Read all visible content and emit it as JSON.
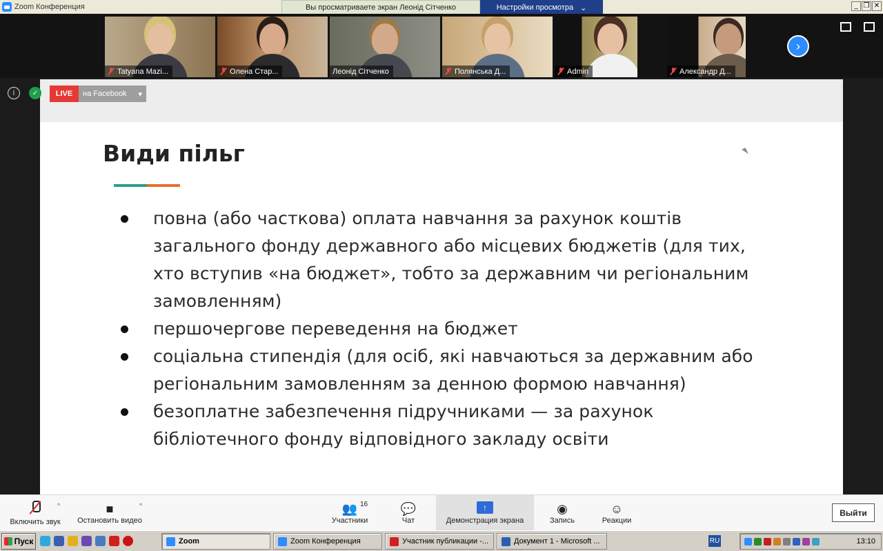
{
  "window": {
    "title": "Zoom Конференция",
    "share_notice": "Вы просматриваете экран Леонід Сітченко",
    "view_settings": "Настройки просмотра",
    "view_settings_caret": "⌄",
    "minimize": "_",
    "restore": "❐",
    "close": "✕"
  },
  "gallery": {
    "participants": [
      {
        "name": "Tatyana Mazi...",
        "muted": true
      },
      {
        "name": "Олена Стар...",
        "muted": true
      },
      {
        "name": "Леонід Сітченко",
        "muted": false,
        "active": true
      },
      {
        "name": "Полянська Д...",
        "muted": true
      },
      {
        "name": "Admin",
        "muted": true
      },
      {
        "name": "Александр Д...",
        "muted": true
      }
    ],
    "next_page": "›"
  },
  "meeting": {
    "info_icon": "i",
    "security_icon": "✓",
    "live_label": "LIVE",
    "live_destination": "на Facebook",
    "live_caret": "▾"
  },
  "slide": {
    "title": "Види пільг",
    "bullets": [
      "повна (або часткова) оплата навчання за рахунок коштів загального фонду державного або місцевих бюджетів (для тих, хто вступив «на бюджет», тобто за державним чи регіональним замовленням)",
      "першочергове переведення на бюджет",
      "соціальна стипендія (для осіб, які навчаються за державним або регіональним замовленням за денною формою навчання)",
      "безоплатне забезпечення підручниками — за рахунок бібліотечного фонду відповідного закладу освіти"
    ],
    "accent_colors": [
      "#2a9d8f",
      "#e76f2a"
    ]
  },
  "toolbar": {
    "unmute": "Включить звук",
    "stop_video": "Остановить видео",
    "participants": "Участники",
    "participants_count": "16",
    "chat": "Чат",
    "share_screen": "Демонстрация экрана",
    "record": "Запись",
    "reactions": "Реакции",
    "leave": "Выйти",
    "caret": "^"
  },
  "taskbar": {
    "start": "Пуск",
    "tasks": [
      {
        "label": "Zoom",
        "active": true
      },
      {
        "label": "Zoom Конференция",
        "active": false
      },
      {
        "label": "Участник публикации -...",
        "active": false
      },
      {
        "label": "Документ 1 - Microsoft ...",
        "active": false
      }
    ],
    "language": "RU",
    "clock": "13:10"
  }
}
